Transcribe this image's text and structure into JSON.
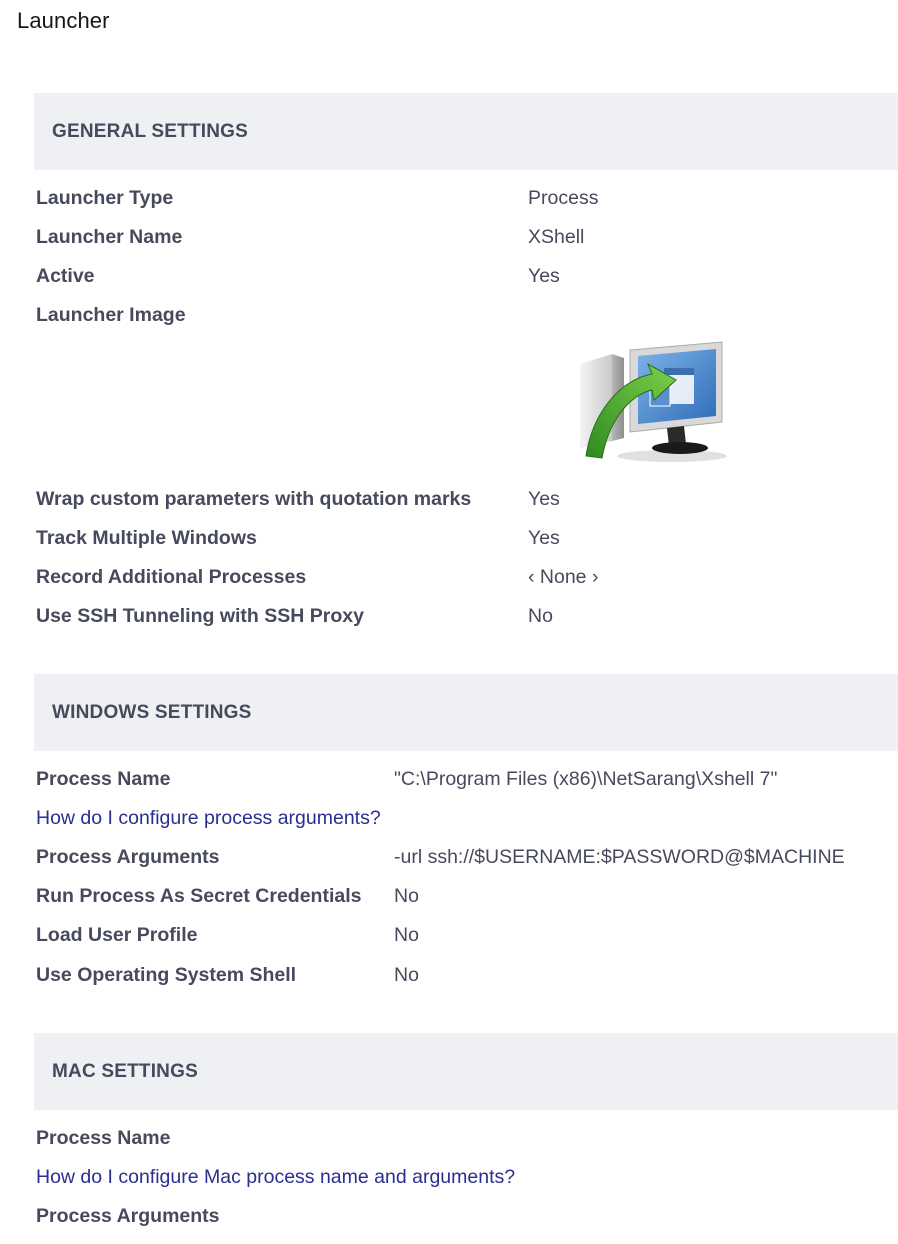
{
  "page": {
    "title": "Launcher"
  },
  "general": {
    "header": "GENERAL SETTINGS",
    "rows": [
      {
        "label": "Launcher Type",
        "value": "Process"
      },
      {
        "label": "Launcher Name",
        "value": "XShell"
      },
      {
        "label": "Active",
        "value": "Yes"
      },
      {
        "label": "Launcher Image",
        "value": ""
      },
      {
        "label": "Wrap custom parameters with quotation marks",
        "value": "Yes"
      },
      {
        "label": "Track Multiple Windows",
        "value": "Yes"
      },
      {
        "label": "Record Additional Processes",
        "value": "‹ None ›"
      },
      {
        "label": "Use SSH Tunneling with SSH Proxy",
        "value": "No"
      }
    ],
    "image_icon": "launcher-monitor-arrow-icon"
  },
  "windows": {
    "header": "WINDOWS SETTINGS",
    "process_name_label": "Process Name",
    "process_name_value": "\"C:\\Program Files (x86)\\NetSarang\\Xshell 7\"",
    "help_link": "How do I configure process arguments?",
    "process_arguments_label": "Process Arguments",
    "process_arguments_value": "-url ssh://$USERNAME:$PASSWORD@$MACHINE",
    "run_as_label": "Run Process As Secret Credentials",
    "run_as_value": "No",
    "load_profile_label": "Load User Profile",
    "load_profile_value": "No",
    "use_shell_label": "Use Operating System Shell",
    "use_shell_value": "No"
  },
  "mac": {
    "header": "MAC SETTINGS",
    "process_name_label": "Process Name",
    "help_link": "How do I configure Mac process name and arguments?",
    "process_arguments_label": "Process Arguments"
  },
  "colors": {
    "header_bg": "#eef0f3",
    "text": "#474a5c",
    "link": "#2a2e8f"
  }
}
